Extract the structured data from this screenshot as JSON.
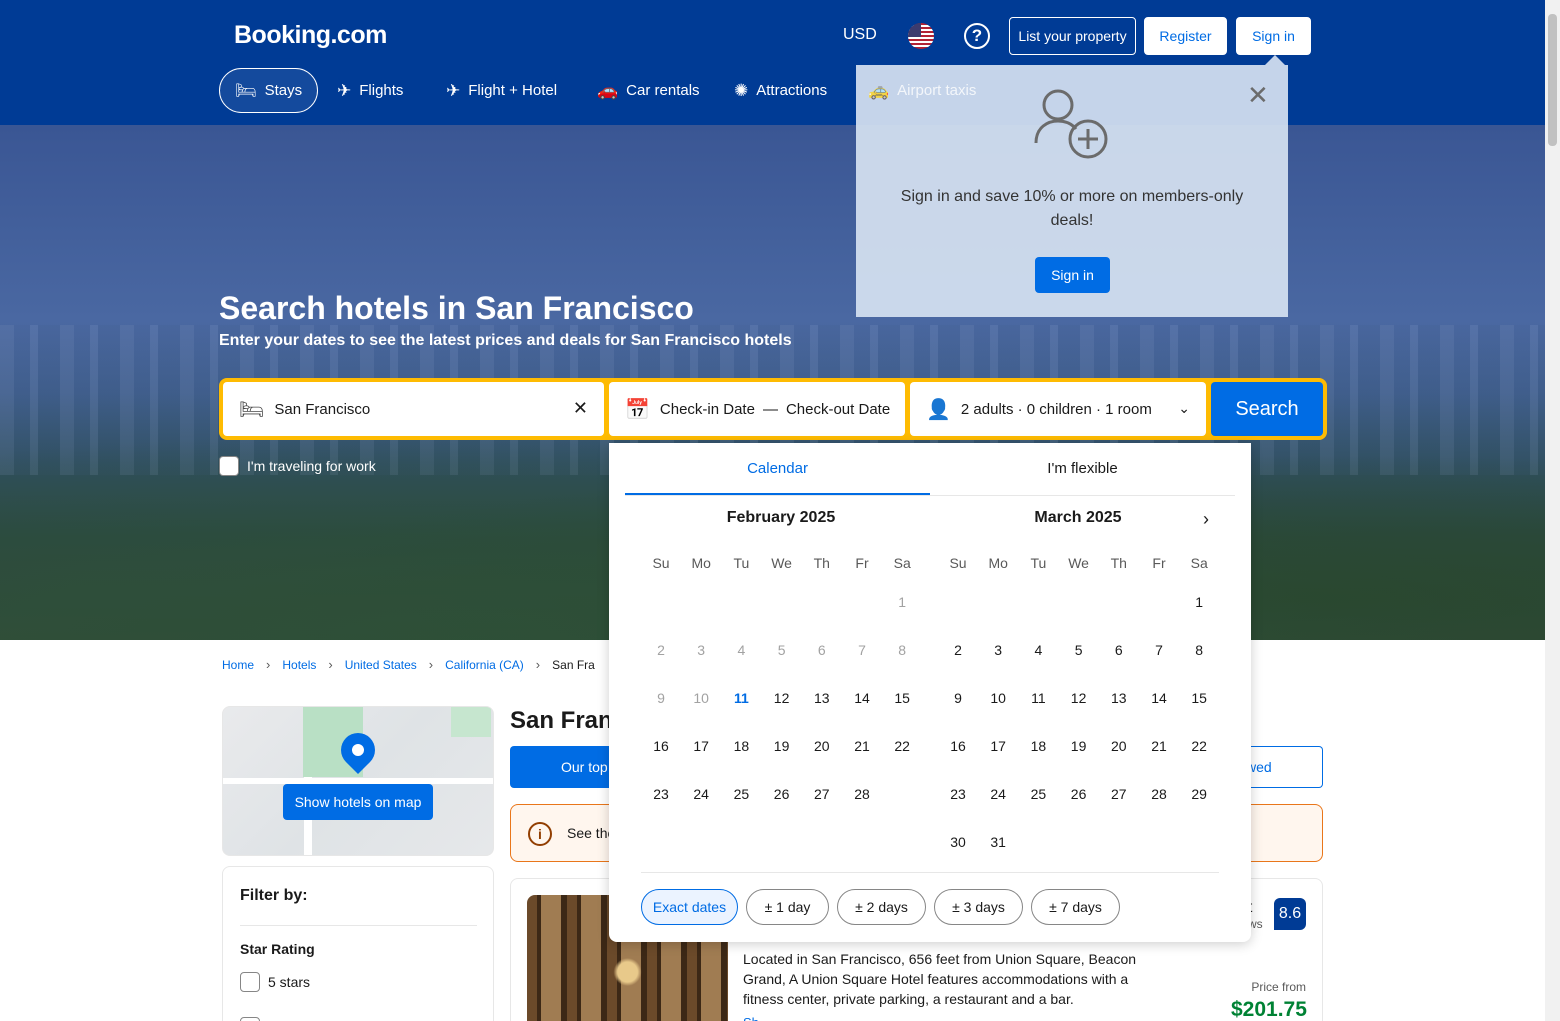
{
  "header": {
    "logo": "Booking.com",
    "currency": "USD",
    "help_symbol": "?",
    "list_property": "List your property",
    "register": "Register",
    "sign_in": "Sign in"
  },
  "nav": {
    "items": [
      {
        "label": "Stays",
        "icon": "bed-icon",
        "active": true
      },
      {
        "label": "Flights",
        "icon": "plane-icon"
      },
      {
        "label": "Flight + Hotel",
        "icon": "flight-hotel-icon"
      },
      {
        "label": "Car rentals",
        "icon": "car-icon"
      },
      {
        "label": "Attractions",
        "icon": "attractions-icon"
      },
      {
        "label": "Airport taxis",
        "icon": "taxi-icon"
      }
    ]
  },
  "hero": {
    "title": "Search hotels in San Francisco",
    "subtitle": "Enter your dates to see the latest prices and deals for San Francisco hotels"
  },
  "search": {
    "destination": "San Francisco",
    "checkin": "Check-in Date",
    "date_sep": "—",
    "checkout": "Check-out Date",
    "guests": "2 adults · 0 children · 1 room",
    "button": "Search",
    "work_label": "I'm traveling for work"
  },
  "breadcrumb": {
    "items": [
      "Home",
      "Hotels",
      "United States",
      "California (CA)"
    ],
    "current": "San Fra"
  },
  "map": {
    "button": "Show hotels on map"
  },
  "filter": {
    "title": "Filter by:",
    "star_title": "Star Rating",
    "five_stars": "5 stars"
  },
  "main": {
    "title": "San Fran",
    "tab_top": "Our top",
    "tab_viewed": "wed",
    "info_icon": "i",
    "info_text": "See the"
  },
  "card": {
    "score_label": "nt",
    "score_sub": "ws",
    "score": "8.6",
    "description": "Located in San Francisco, 656 feet from Union Square, Beacon Grand, A Union Square Hotel features accommodations with a fitness center, private parking, a restaurant and a bar.",
    "link": "Sh",
    "price_from": "Price from",
    "price": "$201.75"
  },
  "popup": {
    "text": "Sign in and save 10% or more on members-only deals!",
    "button": "Sign in"
  },
  "calendar": {
    "tab_calendar": "Calendar",
    "tab_flexible": "I'm flexible",
    "weekdays": [
      "Su",
      "Mo",
      "Tu",
      "We",
      "Th",
      "Fr",
      "Sa"
    ],
    "months": [
      {
        "title": "February 2025",
        "first_weekday": 6,
        "days": 28,
        "past_until": 10,
        "today": 11
      },
      {
        "title": "March 2025",
        "first_weekday": 6,
        "days": 31,
        "past_until": 0,
        "today": 0
      }
    ],
    "chips": [
      "Exact dates",
      "± 1 day",
      "± 2 days",
      "± 3 days",
      "± 7 days"
    ]
  },
  "colors": {
    "brand_blue": "#003b95",
    "action_blue": "#006ce4",
    "search_yellow": "#febb02",
    "price_green": "#008234"
  }
}
